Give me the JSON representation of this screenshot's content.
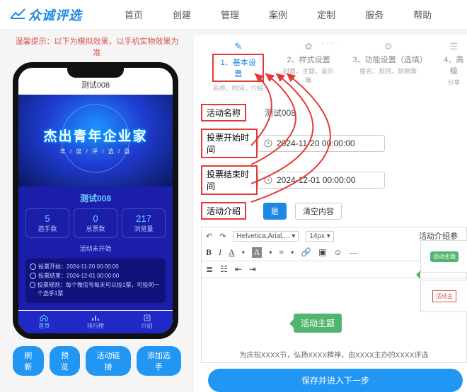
{
  "header": {
    "logo_text": "众诚评选",
    "nav": [
      "首页",
      "创建",
      "管理",
      "案例",
      "定制",
      "服务",
      "帮助"
    ]
  },
  "left": {
    "tip": "温馨提示：以下为模拟效果，以手机实物效果为准",
    "phone_title": "测试008",
    "banner_title": "杰出青年企业家",
    "banner_sub": "年 / 度 / 评 / 选 / 盘",
    "panel_title": "测试008",
    "stats": [
      {
        "n": "5",
        "l": "选手数"
      },
      {
        "n": "0",
        "l": "总票数"
      },
      {
        "n": "217",
        "l": "浏览量"
      }
    ],
    "status_line": "活动未开始",
    "info": {
      "start": "投票开始：2024-11-20 00:00:00",
      "end": "投票结束：2024-12-01 00:00:00",
      "rule": "投票规则：每个微信号每天可以投1票，可投同一个选手1票"
    },
    "tabs": [
      "首页",
      "排行榜",
      "介绍"
    ],
    "buttons": [
      "刷新",
      "预览",
      "活动链接",
      "添加选手"
    ]
  },
  "right": {
    "steps": [
      {
        "t": "1、基本设置",
        "s": "名称，时间，介绍"
      },
      {
        "t": "2、样式设置",
        "s": "封面，主题，音乐等"
      },
      {
        "t": "3、功能设置（选填）",
        "s": "报名，规则，防刷等"
      },
      {
        "t": "4、高级",
        "s": "分享"
      }
    ],
    "labels": {
      "name": "活动名称",
      "start": "投票开始时间",
      "end": "投票结束时间",
      "intro": "活动介绍"
    },
    "values": {
      "name": "测试008",
      "start": "2024-11-20 00:00:00",
      "end": "2024-12-01 00:00:00"
    },
    "toggle_yes": "是",
    "clear": "清空内容",
    "font_family": "Helvetica,Arial,...",
    "font_size": "14px",
    "ref_title": "活动介绍参",
    "theme1": "活动主题",
    "theme2": "活动主",
    "editor_footer": "为庆祝XXXX节，弘扬XXXX精神，由XXXX主办的XXXX评选",
    "save": "保存并进入下一步"
  }
}
